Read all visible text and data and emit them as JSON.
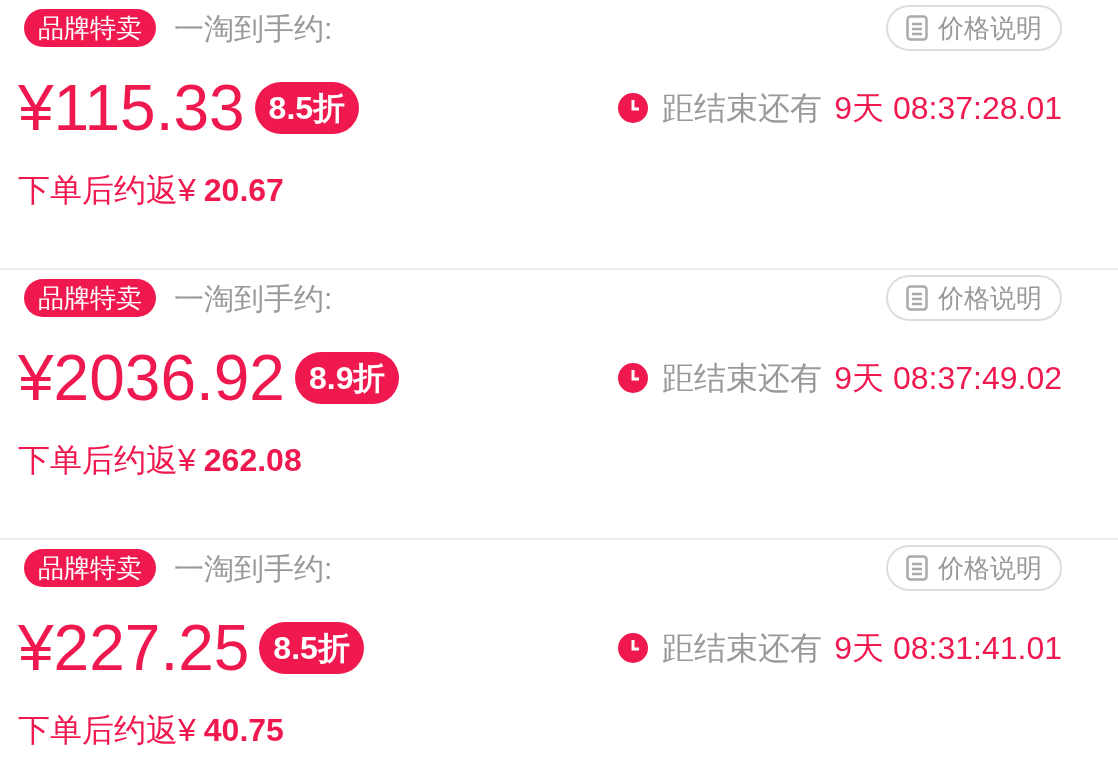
{
  "offers": [
    {
      "badge": "品牌特卖",
      "label": "一淘到手约:",
      "price_note": "价格说明",
      "price": "¥115.33",
      "discount": "8.5折",
      "countdown_label": "距结束还有",
      "countdown": "9天 08:37:28.01",
      "rebate_label": "下单后约返¥",
      "rebate": "20.67"
    },
    {
      "badge": "品牌特卖",
      "label": "一淘到手约:",
      "price_note": "价格说明",
      "price": "¥2036.92",
      "discount": "8.9折",
      "countdown_label": "距结束还有",
      "countdown": "9天 08:37:49.02",
      "rebate_label": "下单后约返¥",
      "rebate": "262.08"
    },
    {
      "badge": "品牌特卖",
      "label": "一淘到手约:",
      "price_note": "价格说明",
      "price": "¥227.25",
      "discount": "8.5折",
      "countdown_label": "距结束还有",
      "countdown": "9天 08:31:41.01",
      "rebate_label": "下单后约返¥",
      "rebate": "40.75"
    }
  ]
}
